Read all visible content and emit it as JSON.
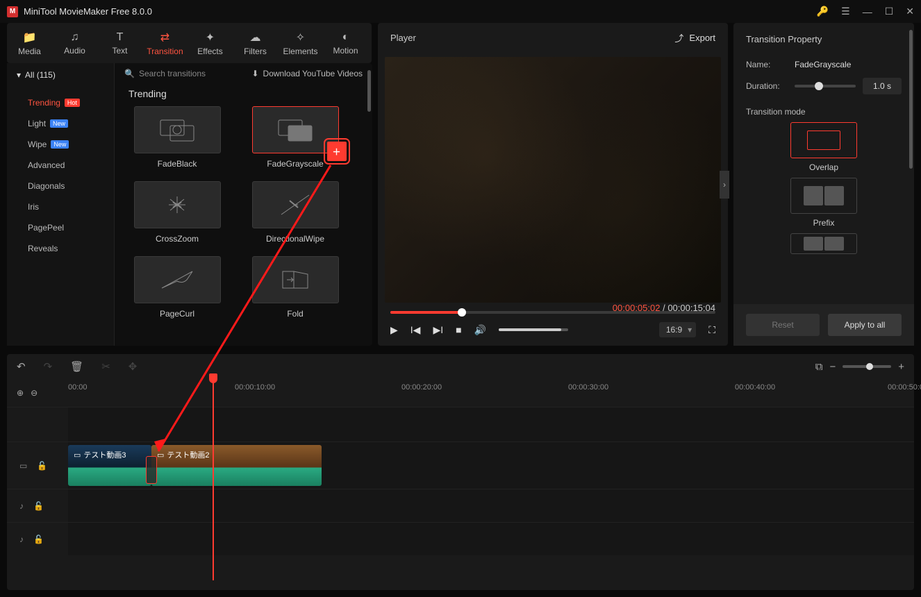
{
  "app": {
    "title": "MiniTool MovieMaker Free 8.0.0"
  },
  "toolbar": [
    {
      "id": "media",
      "label": "Media",
      "icon": "folder"
    },
    {
      "id": "audio",
      "label": "Audio",
      "icon": "music"
    },
    {
      "id": "text",
      "label": "Text",
      "icon": "text"
    },
    {
      "id": "transition",
      "label": "Transition",
      "icon": "swap",
      "active": true
    },
    {
      "id": "effects",
      "label": "Effects",
      "icon": "sparkle"
    },
    {
      "id": "filters",
      "label": "Filters",
      "icon": "cloud"
    },
    {
      "id": "elements",
      "label": "Elements",
      "icon": "star"
    },
    {
      "id": "motion",
      "label": "Motion",
      "icon": "motion"
    }
  ],
  "categories": {
    "header": "All (115)",
    "items": [
      {
        "label": "Trending",
        "badge": "Hot",
        "active": true
      },
      {
        "label": "Light",
        "badge": "New"
      },
      {
        "label": "Wipe",
        "badge": "New"
      },
      {
        "label": "Advanced"
      },
      {
        "label": "Diagonals"
      },
      {
        "label": "Iris"
      },
      {
        "label": "PagePeel"
      },
      {
        "label": "Reveals"
      }
    ]
  },
  "browser": {
    "search_placeholder": "Search transitions",
    "download_label": "Download YouTube Videos",
    "section": "Trending",
    "items": [
      {
        "label": "FadeBlack"
      },
      {
        "label": "FadeGrayscale",
        "selected": true,
        "add": true
      },
      {
        "label": "CrossZoom"
      },
      {
        "label": "DirectionalWipe"
      },
      {
        "label": "PageCurl"
      },
      {
        "label": "Fold"
      }
    ]
  },
  "player": {
    "title": "Player",
    "export": "Export",
    "current": "00:00:05:02",
    "total": "00:00:15:04",
    "ratio": "16:9"
  },
  "properties": {
    "title": "Transition Property",
    "name_label": "Name:",
    "name_value": "FadeGrayscale",
    "duration_label": "Duration:",
    "duration_value": "1.0 s",
    "mode_label": "Transition mode",
    "modes": [
      {
        "label": "Overlap",
        "selected": true
      },
      {
        "label": "Prefix"
      }
    ],
    "reset": "Reset",
    "apply": "Apply to all"
  },
  "timeline": {
    "ticks": [
      "00:00",
      "00:00:10:00",
      "00:00:20:00",
      "00:00:30:00",
      "00:00:40:00",
      "00:00:50:0"
    ],
    "clips": [
      {
        "label": "テスト動画3"
      },
      {
        "label": "テスト動画2"
      }
    ]
  }
}
